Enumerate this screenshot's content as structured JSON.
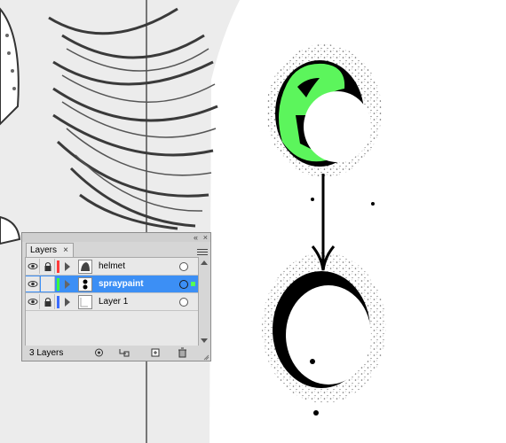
{
  "layers_panel": {
    "tab_label": "Layers",
    "tab_close": "×",
    "collapse_glyph": "«",
    "close_glyph": "×",
    "layer_count": "3 Layers",
    "layers": [
      {
        "name": "helmet",
        "color": "#ff3b3b",
        "visible": true,
        "locked": true,
        "selected": false,
        "thumb_icon": "helmet-thumbnail-icon"
      },
      {
        "name": "spraypaint",
        "color": "#3bff3b",
        "visible": true,
        "locked": false,
        "selected": true,
        "thumb_icon": "spraypaint-thumbnail-icon"
      },
      {
        "name": "Layer 1",
        "color": "#3b6bff",
        "visible": true,
        "locked": true,
        "selected": false,
        "thumb_icon": "layer1-thumbnail-icon"
      }
    ],
    "footer_buttons": [
      "make-clipping-mask-icon",
      "create-sublayer-icon",
      "create-new-layer-icon",
      "delete-layer-icon"
    ]
  },
  "colors": {
    "selection_blue": "#3c8ff5",
    "spray_highlight_green": "#5cf55c"
  }
}
